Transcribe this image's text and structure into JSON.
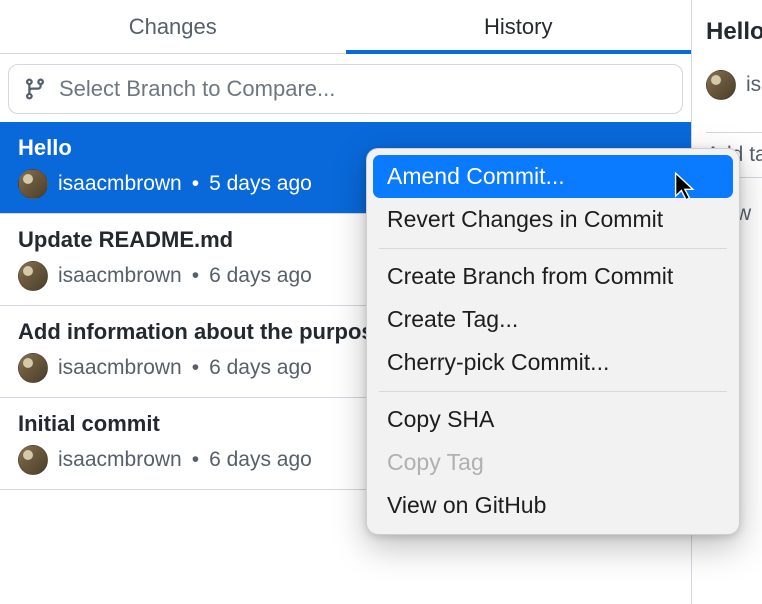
{
  "tabs": {
    "changes": "Changes",
    "history": "History"
  },
  "branchSelector": {
    "placeholder": "Select Branch to Compare..."
  },
  "commits": [
    {
      "title": "Hello",
      "author": "isaacmbrown",
      "time": "5 days ago",
      "selected": true
    },
    {
      "title": "Update README.md",
      "author": "isaacmbrown",
      "time": "6 days ago",
      "selected": false
    },
    {
      "title": "Add information about the purpose",
      "author": "isaacmbrown",
      "time": "6 days ago",
      "selected": false
    },
    {
      "title": "Initial commit",
      "author": "isaacmbrown",
      "time": "6 days ago",
      "selected": false
    }
  ],
  "sidebar": {
    "title": "Hello",
    "author": "isaacmbrown",
    "tagLabel": "Add tag",
    "viewLabel": "View"
  },
  "contextMenu": {
    "items": [
      {
        "label": "Amend Commit...",
        "highlighted": true
      },
      {
        "label": "Revert Changes in Commit"
      },
      {
        "sep": true
      },
      {
        "label": "Create Branch from Commit"
      },
      {
        "label": "Create Tag..."
      },
      {
        "label": "Cherry-pick Commit..."
      },
      {
        "sep": true
      },
      {
        "label": "Copy SHA"
      },
      {
        "label": "Copy Tag",
        "disabled": true
      },
      {
        "label": "View on GitHub"
      }
    ]
  },
  "sep": "•"
}
